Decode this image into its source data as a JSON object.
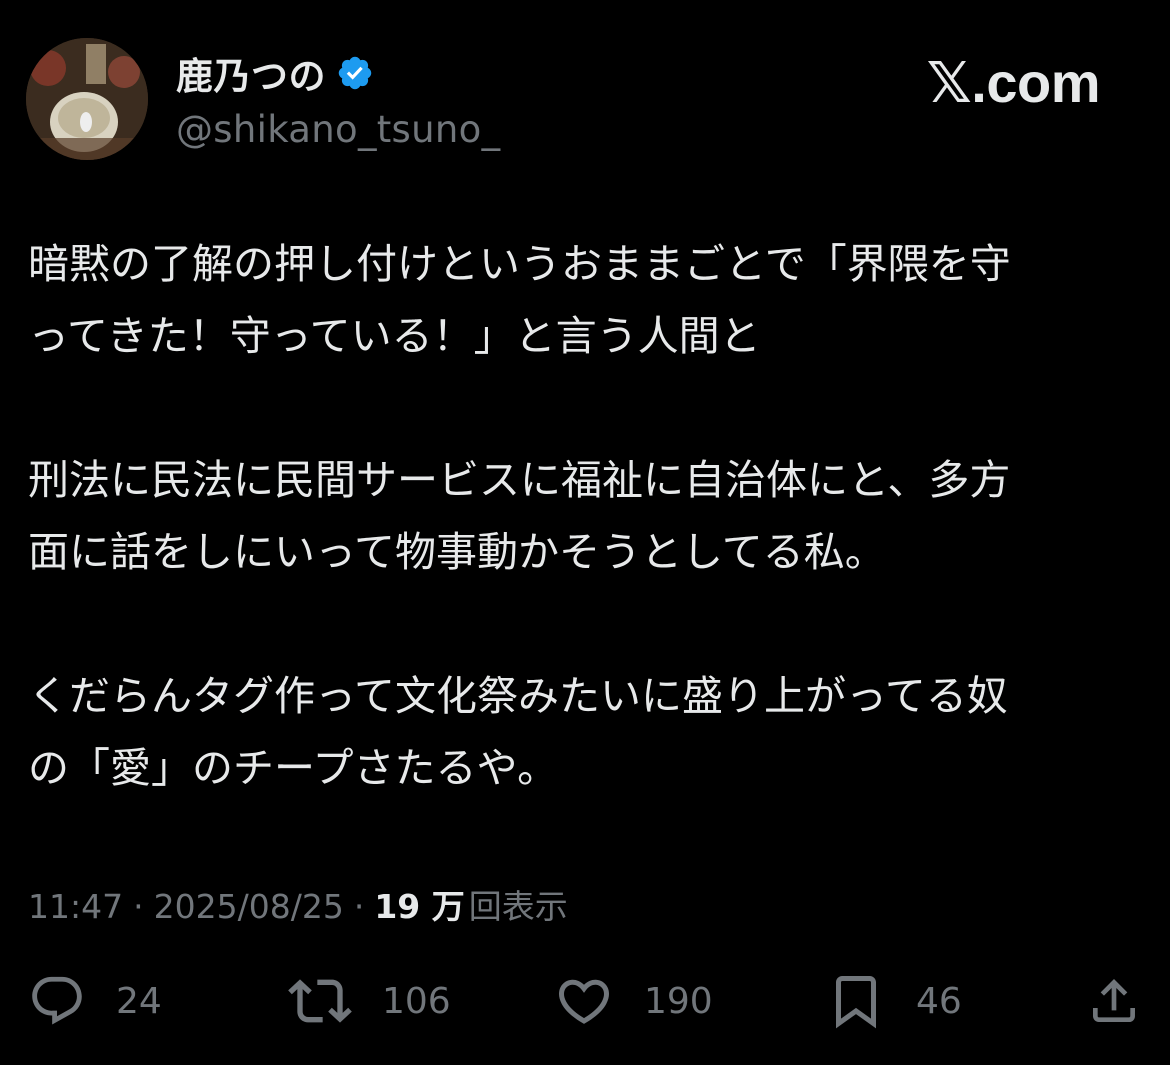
{
  "brand": "𝕏.com",
  "author": {
    "display_name": "鹿乃つの",
    "handle": "@shikano_tsuno_",
    "verified_icon": "verified-badge-icon",
    "avatar_icon": "avatar-photo"
  },
  "tweet": {
    "paragraphs": [
      "暗黙の了解の押し付けというおままごとで「界隈を守\nってきた！守っている！」と言う人間と",
      "刑法に民法に民間サービスに福祉に自治体にと、多方\n面に話をしにいって物事動かそうとしてる私。",
      "くだらんタグ作って文化祭みたいに盛り上がってる奴\nの「愛」のチープさたるや。"
    ]
  },
  "meta": {
    "time": "11:47",
    "separator": "·",
    "date": "2025/08/25",
    "views_count": "19 万",
    "views_label": "回表示"
  },
  "actions": {
    "reply": {
      "icon": "reply-icon",
      "count": "24"
    },
    "repost": {
      "icon": "repost-icon",
      "count": "106"
    },
    "like": {
      "icon": "heart-icon",
      "count": "190"
    },
    "bookmark": {
      "icon": "bookmark-icon",
      "count": "46"
    },
    "share": {
      "icon": "share-icon"
    }
  },
  "colors": {
    "background": "#000000",
    "text": "#e7e9ea",
    "muted": "#71767b",
    "verified": "#1d9bf0"
  }
}
